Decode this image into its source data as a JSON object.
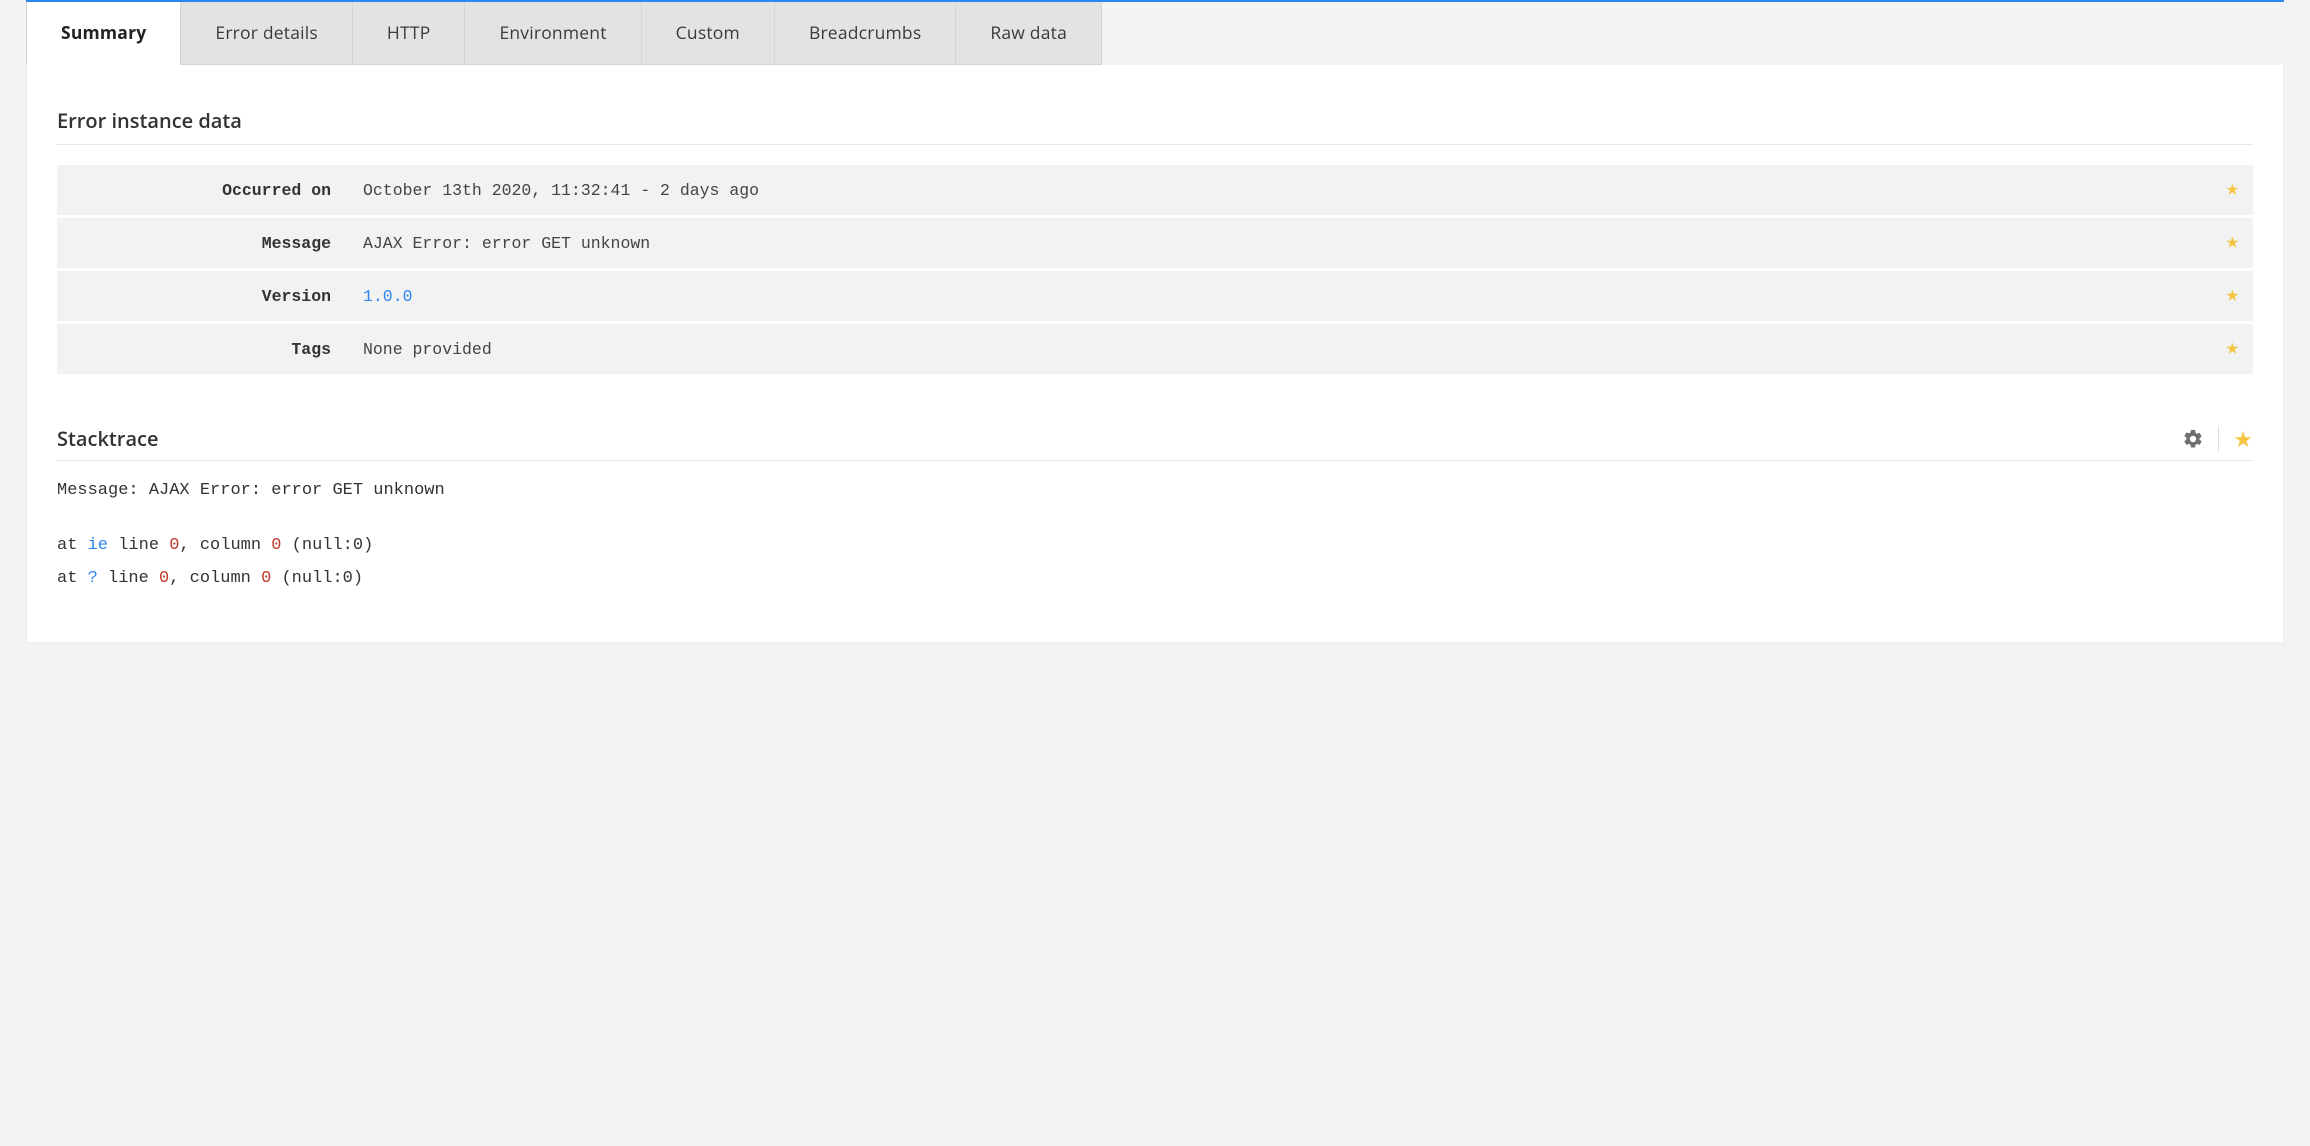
{
  "tabs": {
    "summary": "Summary",
    "error_details": "Error details",
    "http": "HTTP",
    "environment": "Environment",
    "custom": "Custom",
    "breadcrumbs": "Breadcrumbs",
    "raw_data": "Raw data"
  },
  "sections": {
    "instance_title": "Error instance data",
    "stacktrace_title": "Stacktrace"
  },
  "instance": {
    "occurred_label": "Occurred on",
    "occurred_value": "October 13th 2020, 11:32:41 - 2 days ago",
    "message_label": "Message",
    "message_value": "AJAX Error: error GET unknown",
    "version_label": "Version",
    "version_value": "1.0.0",
    "tags_label": "Tags",
    "tags_value": "None provided"
  },
  "stacktrace": {
    "message_prefix": "Message: ",
    "message_value": "AJAX Error: error GET unknown",
    "frames": [
      {
        "at": "at ",
        "fn": "ie",
        "sp1": " line ",
        "line": "0",
        "sp2": ", column ",
        "col": "0",
        "loc": " (null:0)"
      },
      {
        "at": "at ",
        "fn": "?",
        "sp1": " line ",
        "line": "0",
        "sp2": ", column ",
        "col": "0",
        "loc": " (null:0)"
      }
    ]
  }
}
